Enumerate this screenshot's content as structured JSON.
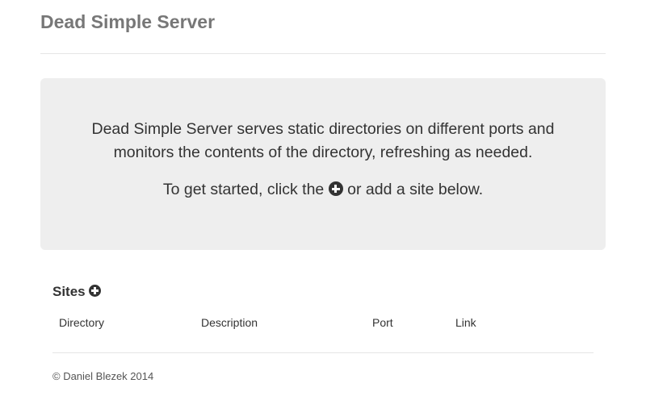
{
  "header": {
    "title": "Dead Simple Server"
  },
  "jumbotron": {
    "intro": "Dead Simple Server serves static directories on different ports and monitors the contents of the directory, refreshing as needed.",
    "cta_before": "To get started, click the",
    "cta_after": "or add a site below.",
    "add_icon": "plus-circle-icon"
  },
  "sites": {
    "heading": "Sites",
    "add_icon": "plus-circle-icon",
    "columns": [
      "Directory",
      "Description",
      "Port",
      "Link"
    ],
    "rows": []
  },
  "footer": {
    "copyright": "© Daniel Blezek 2014"
  }
}
